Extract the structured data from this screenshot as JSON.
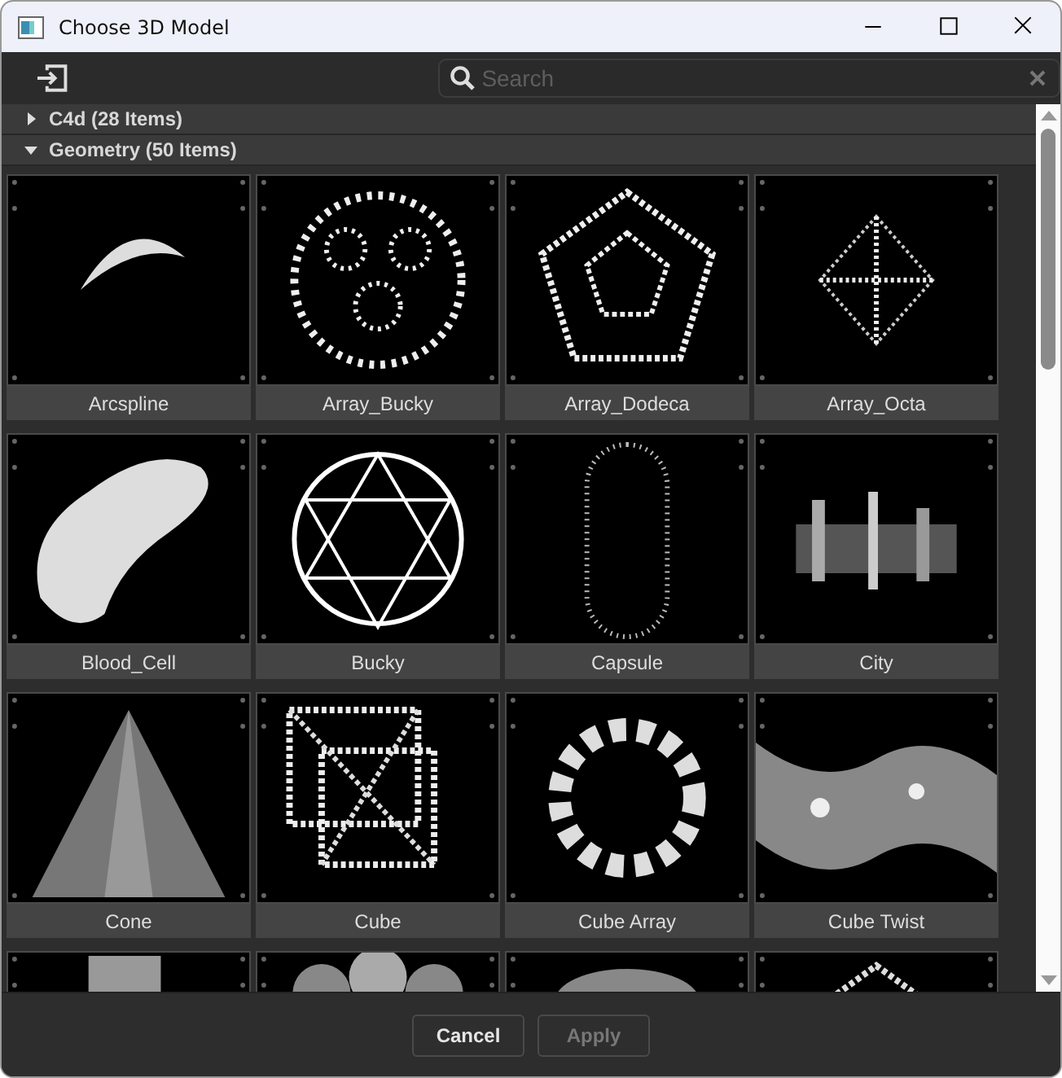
{
  "window": {
    "title": "Choose 3D Model"
  },
  "toolbar": {
    "search": {
      "placeholder": "Search"
    }
  },
  "sections": [
    {
      "label": "C4d (28 Items)",
      "expanded": false
    },
    {
      "label": "Geometry (50 Items)",
      "expanded": true,
      "items": [
        {
          "label": "Arcspline"
        },
        {
          "label": "Array_Bucky"
        },
        {
          "label": "Array_Dodeca"
        },
        {
          "label": "Array_Octa"
        },
        {
          "label": "Blood_Cell"
        },
        {
          "label": "Bucky"
        },
        {
          "label": "Capsule"
        },
        {
          "label": "City"
        },
        {
          "label": "Cone"
        },
        {
          "label": "Cube"
        },
        {
          "label": "Cube Array"
        },
        {
          "label": "Cube Twist"
        },
        {
          "kind": "picture"
        },
        {
          "kind": "picture"
        },
        {
          "kind": "picture"
        },
        {
          "kind": "picture"
        }
      ]
    }
  ],
  "buttons": [
    {
      "label": "Cancel",
      "disabled": false
    },
    {
      "label": "Apply",
      "disabled": true
    }
  ]
}
